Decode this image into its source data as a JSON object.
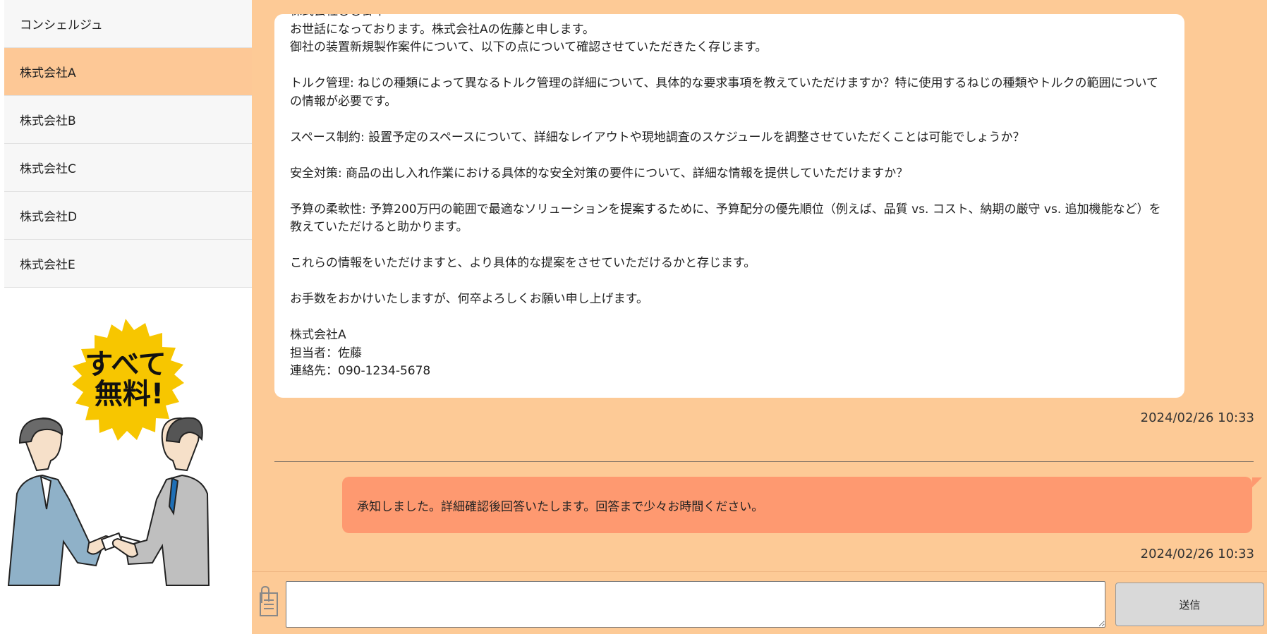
{
  "sidebar": {
    "items": [
      {
        "label": "コンシェルジュ",
        "active": false
      },
      {
        "label": "株式会社A",
        "active": true
      },
      {
        "label": "株式会社B",
        "active": false
      },
      {
        "label": "株式会社C",
        "active": false
      },
      {
        "label": "株式会社D",
        "active": false
      },
      {
        "label": "株式会社E",
        "active": false
      }
    ],
    "promo": {
      "badge_line1": "すべて",
      "badge_line2": "無料!"
    }
  },
  "chat": {
    "message": {
      "text": "株式会社〇〇御中\nお世話になっております。株式会社Aの佐藤と申します。\n御社の装置新規製作案件について、以下の点について確認させていただきたく存じます。\n\nトルク管理: ねじの種類によって異なるトルク管理の詳細について、具体的な要求事項を教えていただけますか？特に使用するねじの種類やトルクの範囲についての情報が必要です。\n\nスペース制約: 設置予定のスペースについて、詳細なレイアウトや現地調査のスケジュールを調整させていただくことは可能でしょうか？\n\n安全対策: 商品の出し入れ作業における具体的な安全対策の要件について、詳細な情報を提供していただけますか？\n\n予算の柔軟性: 予算200万円の範囲で最適なソリューションを提案するために、予算配分の優先順位（例えば、品質 vs. コスト、納期の厳守 vs. 追加機能など）を教えていただけると助かります。\n\nこれらの情報をいただけますと、より具体的な提案をさせていただけるかと存じます。\n\nお手数をおかけいたしますが、何卒よろしくお願い申し上げます。\n\n株式会社A\n担当者：佐藤\n連絡先：090-1234-5678",
      "timestamp": "2024/02/26 10:33"
    },
    "reply": {
      "text": "承知しました。詳細確認後回答いたします。回答まで少々お時間ください。",
      "timestamp": "2024/02/26 10:33"
    }
  },
  "composer": {
    "input_value": "",
    "send_label": "送信"
  },
  "colors": {
    "accent": "#fdca96",
    "active_item": "#fdc896",
    "reply_bubble": "#fe9970",
    "badge": "#f7c600"
  }
}
